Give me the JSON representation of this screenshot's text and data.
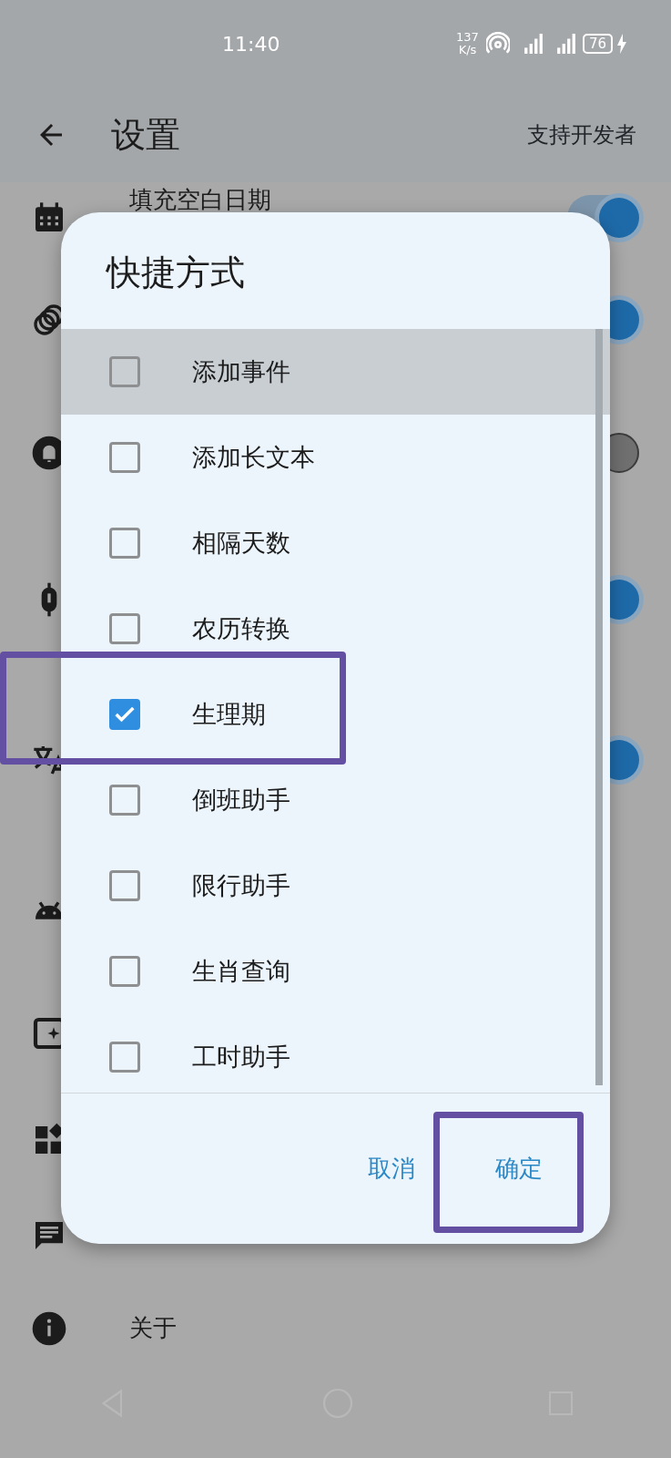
{
  "status_bar": {
    "time": "11:40",
    "speed_value": "137",
    "speed_unit": "K/s",
    "battery": "76"
  },
  "app_bar": {
    "title": "设置",
    "action": "支持开发者"
  },
  "settings": [
    {
      "kind": "toggle",
      "label": "填充空白日期",
      "on": true
    },
    {
      "kind": "toggle",
      "on": true
    },
    {
      "kind": "toggle",
      "on": false
    },
    {
      "kind": "toggle",
      "on": true
    },
    {
      "kind": "toggle",
      "on": true
    },
    {
      "kind": "link"
    },
    {
      "kind": "link"
    },
    {
      "kind": "link"
    },
    {
      "kind": "link"
    },
    {
      "kind": "link",
      "label": "关于"
    }
  ],
  "dialog": {
    "title": "快捷方式",
    "options": [
      {
        "label": "添加事件",
        "checked": false,
        "pressed": true
      },
      {
        "label": "添加长文本",
        "checked": false,
        "pressed": false
      },
      {
        "label": "相隔天数",
        "checked": false,
        "pressed": false
      },
      {
        "label": "农历转换",
        "checked": false,
        "pressed": false
      },
      {
        "label": "生理期",
        "checked": true,
        "pressed": false
      },
      {
        "label": "倒班助手",
        "checked": false,
        "pressed": false
      },
      {
        "label": "限行助手",
        "checked": false,
        "pressed": false
      },
      {
        "label": "生肖查询",
        "checked": false,
        "pressed": false
      },
      {
        "label": "工时助手",
        "checked": false,
        "pressed": false
      }
    ],
    "buttons": [
      "取消",
      "确定"
    ]
  }
}
